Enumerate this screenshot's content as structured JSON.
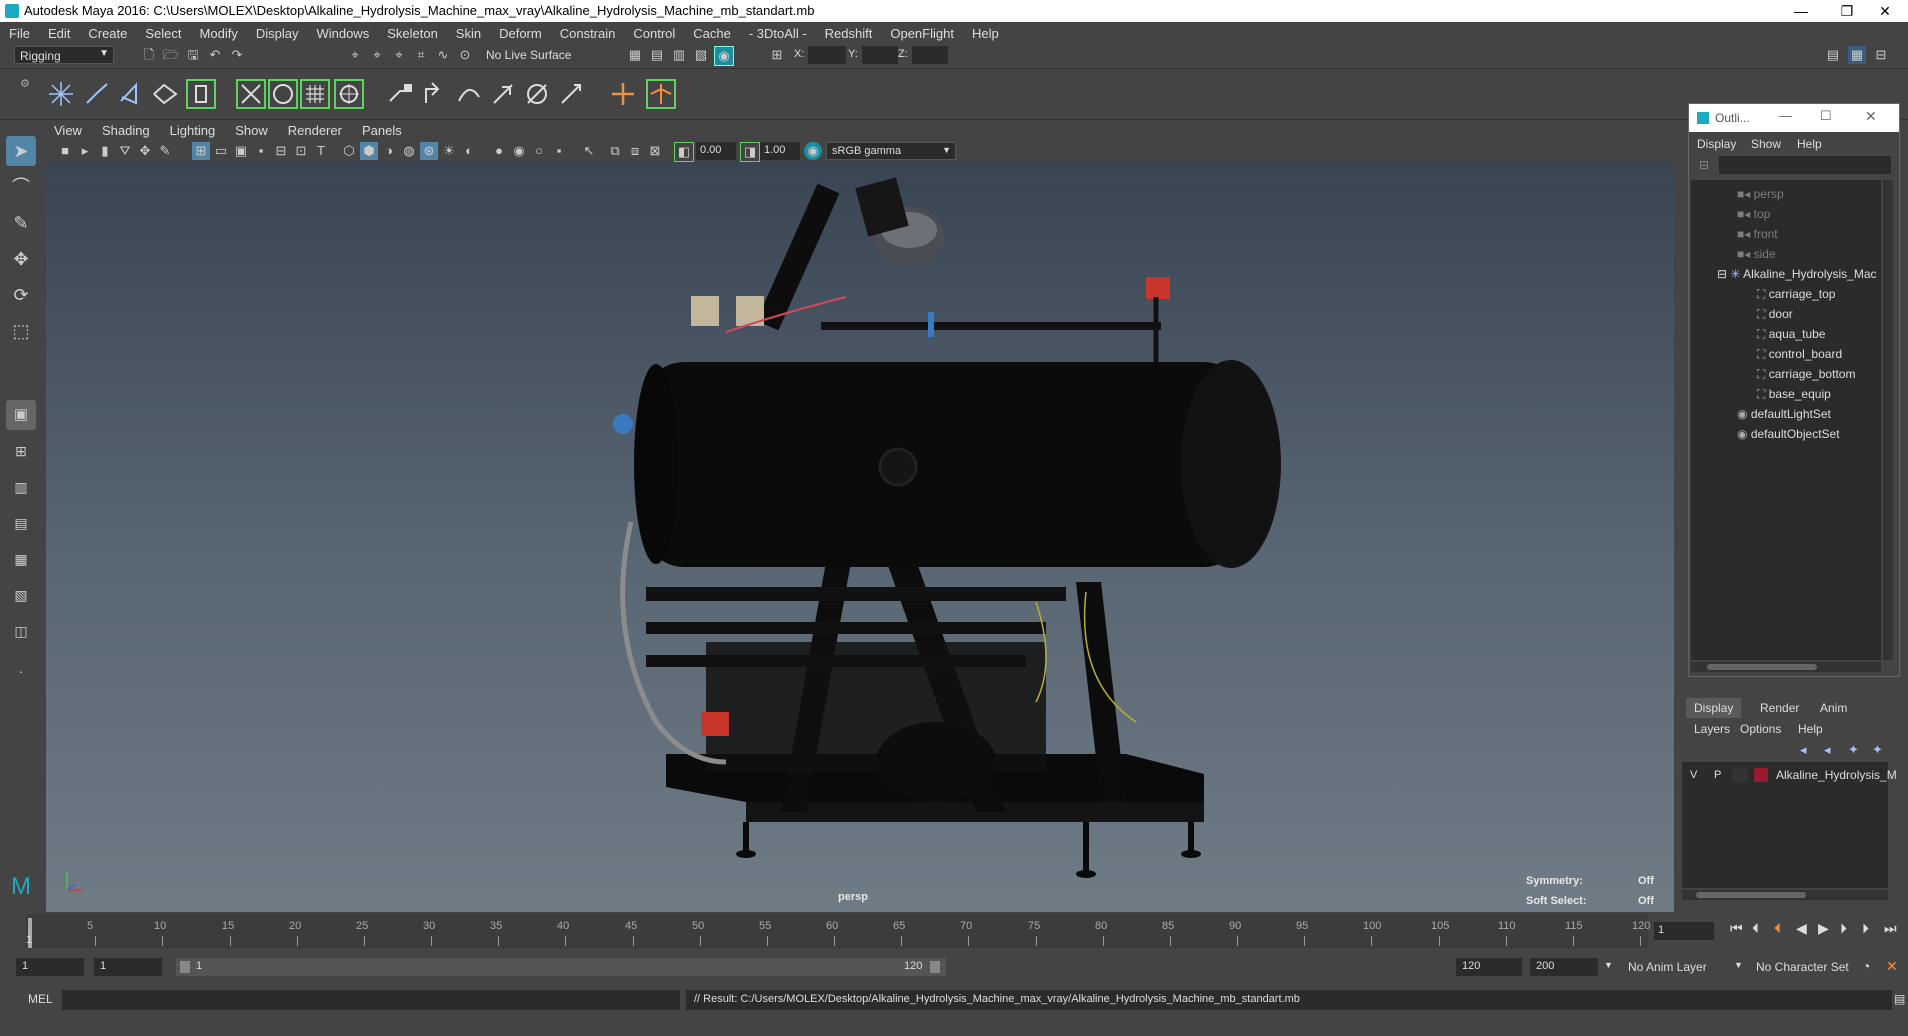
{
  "window": {
    "title": "Autodesk Maya 2016: C:\\Users\\MOLEX\\Desktop\\Alkaline_Hydrolysis_Machine_max_vray\\Alkaline_Hydrolysis_Machine_mb_standart.mb",
    "minimize": "—",
    "maximize": "❐",
    "close": "✕"
  },
  "menubar": [
    "File",
    "Edit",
    "Create",
    "Select",
    "Modify",
    "Display",
    "Windows",
    "Skeleton",
    "Skin",
    "Deform",
    "Constrain",
    "Control",
    "Cache",
    "- 3DtoAll -",
    "Redshift",
    "OpenFlight",
    "Help"
  ],
  "statusline": {
    "mode": "Rigging",
    "live_surface": "No Live Surface",
    "x_label": "X:",
    "y_label": "Y:",
    "z_label": "Z:"
  },
  "viewport": {
    "menu": [
      "View",
      "Shading",
      "Lighting",
      "Show",
      "Renderer",
      "Panels"
    ],
    "exposure": "0.00",
    "gamma": "1.00",
    "color_space": "sRGB gamma",
    "camera_label": "persp",
    "hud": {
      "symmetry_label": "Symmetry:",
      "symmetry_value": "Off",
      "soft_select_label": "Soft Select:",
      "soft_select_value": "Off"
    }
  },
  "outliner": {
    "title": "Outli...",
    "menu": [
      "Display",
      "Show",
      "Help"
    ],
    "items": [
      {
        "label": "persp",
        "dim": true
      },
      {
        "label": "top",
        "dim": true
      },
      {
        "label": "front",
        "dim": true
      },
      {
        "label": "side",
        "dim": true
      },
      {
        "label": "Alkaline_Hydrolysis_Mac",
        "dim": false
      },
      {
        "label": "carriage_top",
        "dim": false
      },
      {
        "label": "door",
        "dim": false
      },
      {
        "label": "aqua_tube",
        "dim": false
      },
      {
        "label": "control_board",
        "dim": false
      },
      {
        "label": "carriage_bottom",
        "dim": false
      },
      {
        "label": "base_equip",
        "dim": false
      },
      {
        "label": "defaultLightSet",
        "dim": false
      },
      {
        "label": "defaultObjectSet",
        "dim": false
      }
    ]
  },
  "layer_editor": {
    "tabs": [
      "Display",
      "Render",
      "Anim"
    ],
    "menu": [
      "Layers",
      "Options",
      "Help"
    ],
    "layer": {
      "v": "V",
      "p": "P",
      "name": "Alkaline_Hydrolysis_M",
      "color": "#9b1b2e"
    }
  },
  "timeline": {
    "ticks": [
      "5",
      "10",
      "15",
      "20",
      "25",
      "30",
      "35",
      "40",
      "45",
      "50",
      "55",
      "60",
      "65",
      "70",
      "75",
      "80",
      "85",
      "90",
      "95",
      "100",
      "105",
      "110",
      "115",
      "120"
    ],
    "start_label": "1",
    "current_frame": "1"
  },
  "range": {
    "start": "1",
    "playback_start": "1",
    "range_start": "1",
    "range_end": "120",
    "playback_end": "120",
    "end": "200",
    "anim_layer": "No Anim Layer",
    "character_set": "No Character Set"
  },
  "command": {
    "lang": "MEL",
    "result": "// Result: C:/Users/MOLEX/Desktop/Alkaline_Hydrolysis_Machine_max_vray/Alkaline_Hydrolysis_Machine_mb_standart.mb"
  }
}
